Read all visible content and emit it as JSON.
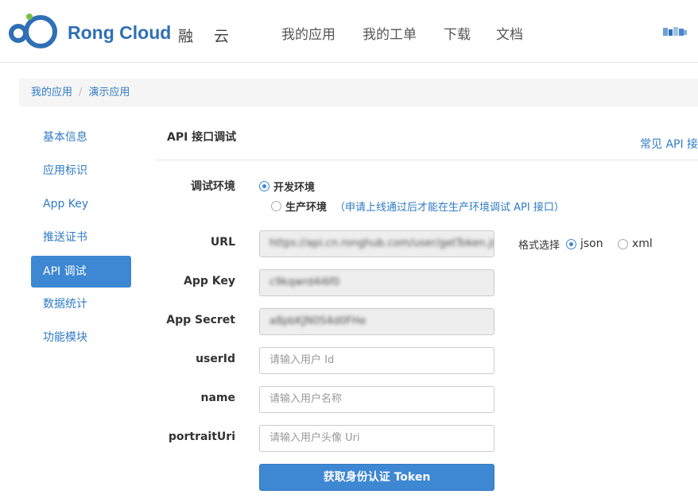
{
  "header": {
    "logo_text": "Rong Cloud",
    "logo_cn": "融 云",
    "nav": [
      "我的应用",
      "我的工单",
      "下载",
      "文档"
    ]
  },
  "breadcrumb": [
    "我的应用",
    "演示应用"
  ],
  "sidebar": {
    "items": [
      "基本信息",
      "应用标识",
      "App Key",
      "推送证书",
      "API 调试",
      "数据统计",
      "功能模块"
    ],
    "active_index": 4
  },
  "main": {
    "title": "API 接口调试",
    "faq_link": "常见 API 接",
    "env": {
      "label": "调试环境",
      "dev": "开发环境",
      "prod": "生产环境",
      "prod_hint": "（申请上线通过后才能在生产环境调试 API 接口）",
      "selected": "dev"
    },
    "url": {
      "label": "URL",
      "value": "https://api.cn.ronghub.com/user/getToken.json"
    },
    "format": {
      "label": "格式选择",
      "json": "json",
      "xml": "xml",
      "selected": "json"
    },
    "app_key": {
      "label": "App Key",
      "value": "c9kqwrd4i6f0"
    },
    "app_secret": {
      "label": "App Secret",
      "value": "a8pbKJN0S4d0FHe"
    },
    "user_id": {
      "label": "userId",
      "placeholder": "请输入用户 Id"
    },
    "name": {
      "label": "name",
      "placeholder": "请输入用户名称"
    },
    "portrait": {
      "label": "portraitUri",
      "placeholder": "请输入用户头像 Uri"
    },
    "submit": "获取身份认证 Token"
  },
  "colors": {
    "accent": "#3d87d3",
    "link": "#2f7bc4",
    "logo": "#2f6fb5"
  }
}
